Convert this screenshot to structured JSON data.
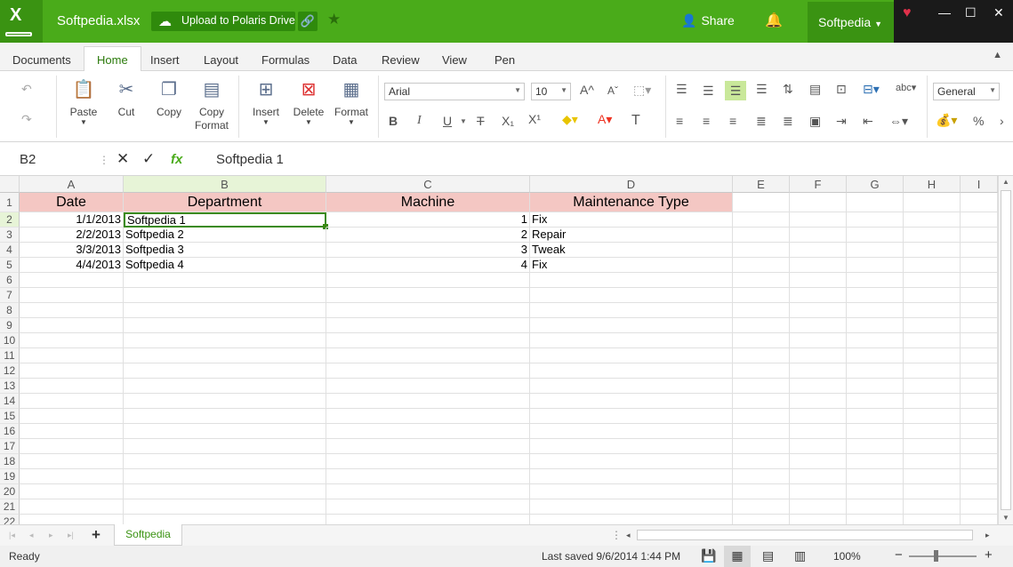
{
  "app": {
    "logo_letter": "X",
    "filename": "Softpedia.xlsx",
    "upload_label": "Upload to Polaris Drive",
    "share_label": "Share",
    "user_label": "Softpedia"
  },
  "tabs": [
    "Documents",
    "Home",
    "Insert",
    "Layout",
    "Formulas",
    "Data",
    "Review",
    "View",
    "Pen"
  ],
  "active_tab": "Home",
  "ribbon": {
    "paste": "Paste",
    "cut": "Cut",
    "copy": "Copy",
    "copy_format": "Copy Format",
    "insert": "Insert",
    "delete": "Delete",
    "format": "Format",
    "font_name": "Arial",
    "font_size": "10",
    "number_format": "General"
  },
  "formula_bar": {
    "cell_ref": "B2",
    "fx": "fx",
    "content": "Softpedia 1"
  },
  "grid": {
    "columns": [
      "A",
      "B",
      "C",
      "D",
      "E",
      "F",
      "G",
      "H",
      "I"
    ],
    "selected_column": "B",
    "selected_row": "2",
    "row_numbers": [
      "1",
      "2",
      "3",
      "4",
      "5",
      "6",
      "7",
      "8",
      "9",
      "10",
      "11",
      "12",
      "13",
      "14",
      "15",
      "16",
      "17",
      "18",
      "19",
      "20",
      "21",
      "22"
    ],
    "header_row": [
      "Date",
      "Department",
      "Machine",
      "Maintenance Type"
    ],
    "rows": [
      [
        "1/1/2013",
        "Softpedia 1",
        "1",
        "Fix"
      ],
      [
        "2/2/2013",
        "Softpedia 2",
        "2",
        "Repair"
      ],
      [
        "3/3/2013",
        "Softpedia 3",
        "3",
        "Tweak"
      ],
      [
        "4/4/2013",
        "Softpedia 4",
        "4",
        "Fix"
      ]
    ]
  },
  "sheet_tab": "Softpedia",
  "status": {
    "ready": "Ready",
    "last_saved": "Last saved 9/6/2014 1:44 PM",
    "zoom": "100%"
  },
  "colors": {
    "brand_green": "#4aab1a",
    "header_fill": "#f4c7c3",
    "selection": "#3a8a12"
  }
}
